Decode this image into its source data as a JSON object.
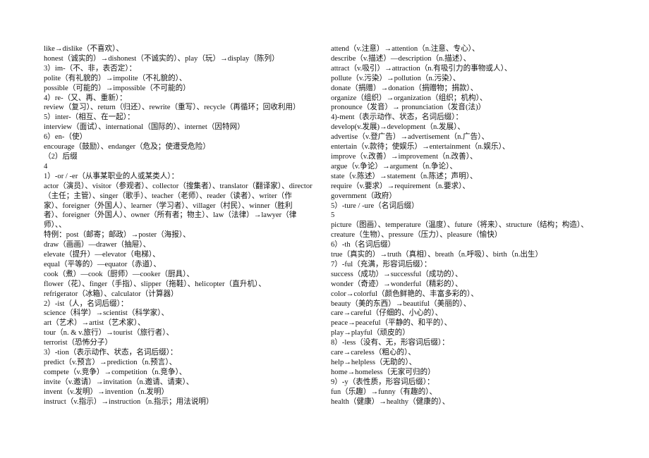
{
  "left": {
    "lines": [
      "like→dislike（不喜欢）、",
      "honest（诚实的）→dishonest（不诚实的）、play（玩）→display（陈列）",
      "3）im-（不、非，表否定）：",
      "polite（有礼貌的）→impolite（不礼貌的）、",
      "possible（可能的）→impossible（不可能的）",
      "4）re-（又、再、重新）：",
      "review（复习）、return（归还）、rewrite（重写）、recycle（再循环；回收利用）",
      "5）inter-（相互、在一起）：",
      "interview（面试）、international（国际的）、internet（因特网）",
      "6）en-（使）",
      "encourage（鼓励）、endanger（危及；使遭受危险）",
      "（2）后缀",
      "4",
      "1）-or / -er（从事某职业的人或某类人）：",
      "actor（演员）、visitor（参观者）、collector（搜集者）、translator（翻译家）、director",
      "（主任；主管）、singer（歌手）、teacher（老师）、reader（读者）、writer（作",
      "家）、foreigner（外国人）、learner（学习者）、villager（村民）、winner（胜利",
      "者）、foreigner（外国人）、owner（所有者；物主）、law（法律）→lawyer（律",
      "师）、、",
      "特例：post（邮寄；邮政）→poster（海报）、",
      "draw（画画）—drawer（抽屉）、",
      "elevate（提升）—elevator（电梯）、",
      "equal（平等的）—equator（赤道）、",
      "cook（煮）—cook（厨师）—cooker（厨具）、",
      "flower（花）、finger（手指）、slipper（拖鞋）、helicopter（直升机）、",
      "refrigerator（冰箱）、calculator（计算器）",
      "2）-ist（人，名词后缀）：",
      "science（科学）→scientist（科学家）、",
      "art（艺术）→artist（艺术家）、",
      "tour（n. & v.旅行）→tourist（旅行者）、",
      "terrorist（恐怖分子）",
      "3）-tion（表示动作、状态，名词后缀）：",
      "predict（v.预言）→prediction（n.预言）、",
      "compete（v.竞争）→competition（n.竞争）、",
      "invite（v.邀请）→invitation（n.邀请、请柬）、",
      "invent（v.发明）→invention（n.发明）",
      "instruct（v.指示）→instruction（n.指示；用法说明）"
    ]
  },
  "right": {
    "lines": [
      "attend（v.注意）→attention（n.注意、专心）、",
      "describe（v.描述）—description（n.描述）、",
      "attract（v.吸引）→attraction（n.有吸引力的事物或人）、",
      "pollute（v.污染）→pollution（n.污染）、",
      "donate（捐赠）→donation（捐赠物；捐款）、",
      "organize（组织）→organization（组织；机构）、",
      "pronounce（发音）→ pronunciation（发音(法)）",
      "4)-ment（表示动作、状态，名词后缀）：",
      "develop(v.发展)→development（n.发展）、",
      "advertise（v.登广告）→advertisement（n.广告）、",
      "entertain（v.款待；使娱乐）→entertainment（n.娱乐）、",
      "improve（v.改善）→improvement（n.改善）、",
      "argue（v.争论）→argument（n.争论）、",
      "state（v.陈述）→statement（n.陈述；声明）、",
      "require（v.要求）→requirement（n.要求）、",
      "government（政府）",
      "5）-ture / -ure（名词后缀）",
      "5",
      "picture（图画）、temperature（温度）、future（将来）、structure（结构；构造）、",
      "creature（生物）、pressure（压力）、pleasure（愉快）",
      "6）-th（名词后缀）",
      "true（真实的）→truth（真相）、breath（n.呼吸）、birth（n.出生）",
      "7）-ful（充满，形容词后缀）：",
      "success（成功）→successful（成功的）、",
      "wonder（奇迹）→wonderful（精彩的）、",
      "color→colorful（颜色鲜艳的、丰富多彩的）、",
      "beauty（美的东西）→beautiful（美丽的）、",
      "care→careful（仔细的、小心的）、",
      "peace→peaceful（平静的、和平的）、",
      "play→playful（顽皮的）",
      "8）-less（没有、无，形容词后缀）：",
      "care→careless（粗心的）、",
      "help→helpless（无助的）、",
      "home→homeless（无家可归的）",
      "9）-y（表性质，形容词后缀）：",
      "fun（乐趣）→funny（有趣的）、",
      "health（健康）→healthy（健康的）、"
    ]
  }
}
